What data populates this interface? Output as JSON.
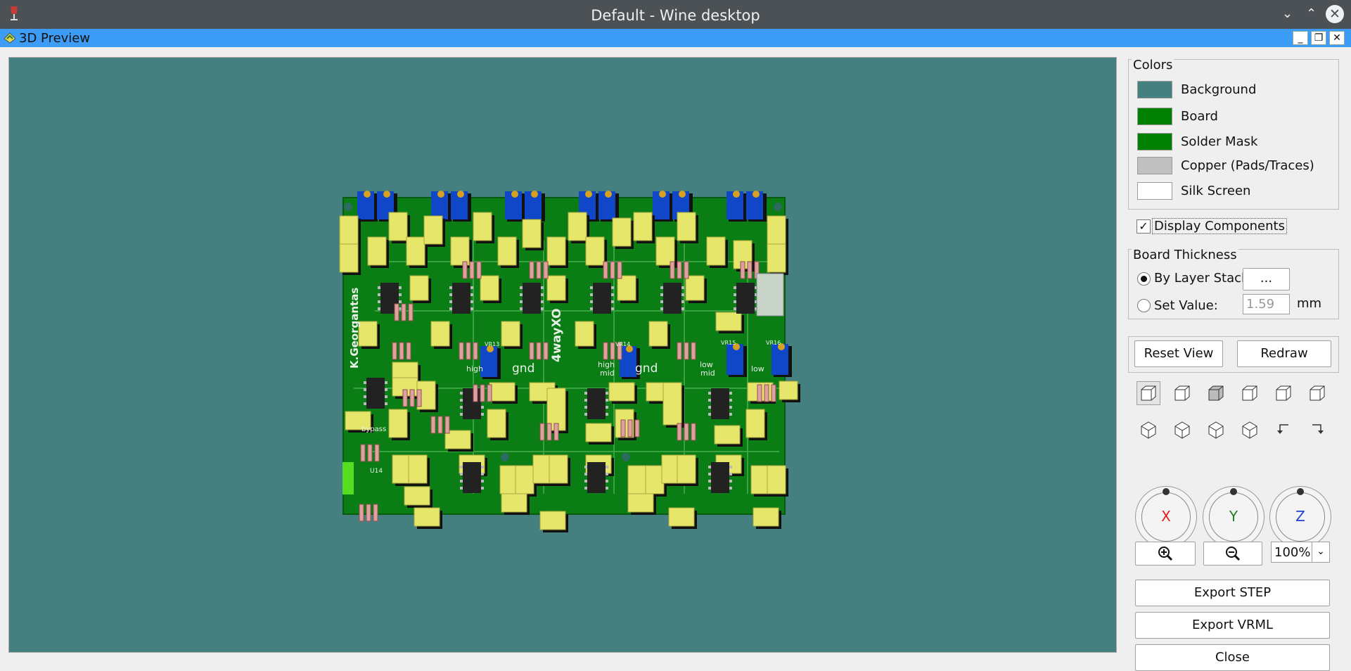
{
  "window": {
    "title": "Default - Wine desktop",
    "app_icon": "wine-glass-icon"
  },
  "dialog": {
    "title": "3D Preview"
  },
  "pcb": {
    "labels": {
      "author": "K.Georgantas",
      "project": "4wayXO",
      "gnd1": "gnd",
      "gnd2": "gnd",
      "high": "high",
      "high_mid": "high\nmid",
      "low_mid": "low\nmid",
      "low": "low",
      "bypass": "bypass",
      "u14": "U14",
      "vr13": "VR13",
      "vr14": "VR14",
      "vr15": "VR15",
      "vr16": "VR16"
    }
  },
  "colors": {
    "title": "Colors",
    "items": [
      {
        "label": "Background",
        "color": "#44807f"
      },
      {
        "label": "Board",
        "color": "#008000"
      },
      {
        "label": "Solder Mask",
        "color": "#008000"
      },
      {
        "label": "Copper (Pads/Traces)",
        "color": "#c0c0c0"
      },
      {
        "label": "Silk Screen",
        "color": "#ffffff"
      }
    ]
  },
  "display_components": {
    "label": "Display Components",
    "checked": true
  },
  "board_thickness": {
    "title": "Board Thickness",
    "by_layer_stackup": "By Layer Stackup",
    "stackup_button": "...",
    "set_value": "Set Value:",
    "value": "1.59",
    "unit": "mm"
  },
  "buttons": {
    "reset_view": "Reset View",
    "redraw": "Redraw",
    "export_step": "Export STEP",
    "export_vrml": "Export VRML",
    "close": "Close"
  },
  "rotation": {
    "x": "X",
    "y": "Y",
    "z": "Z",
    "x_color": "#e02020",
    "y_color": "#208020",
    "z_color": "#2040d0"
  },
  "zoom": {
    "value": "100%"
  }
}
